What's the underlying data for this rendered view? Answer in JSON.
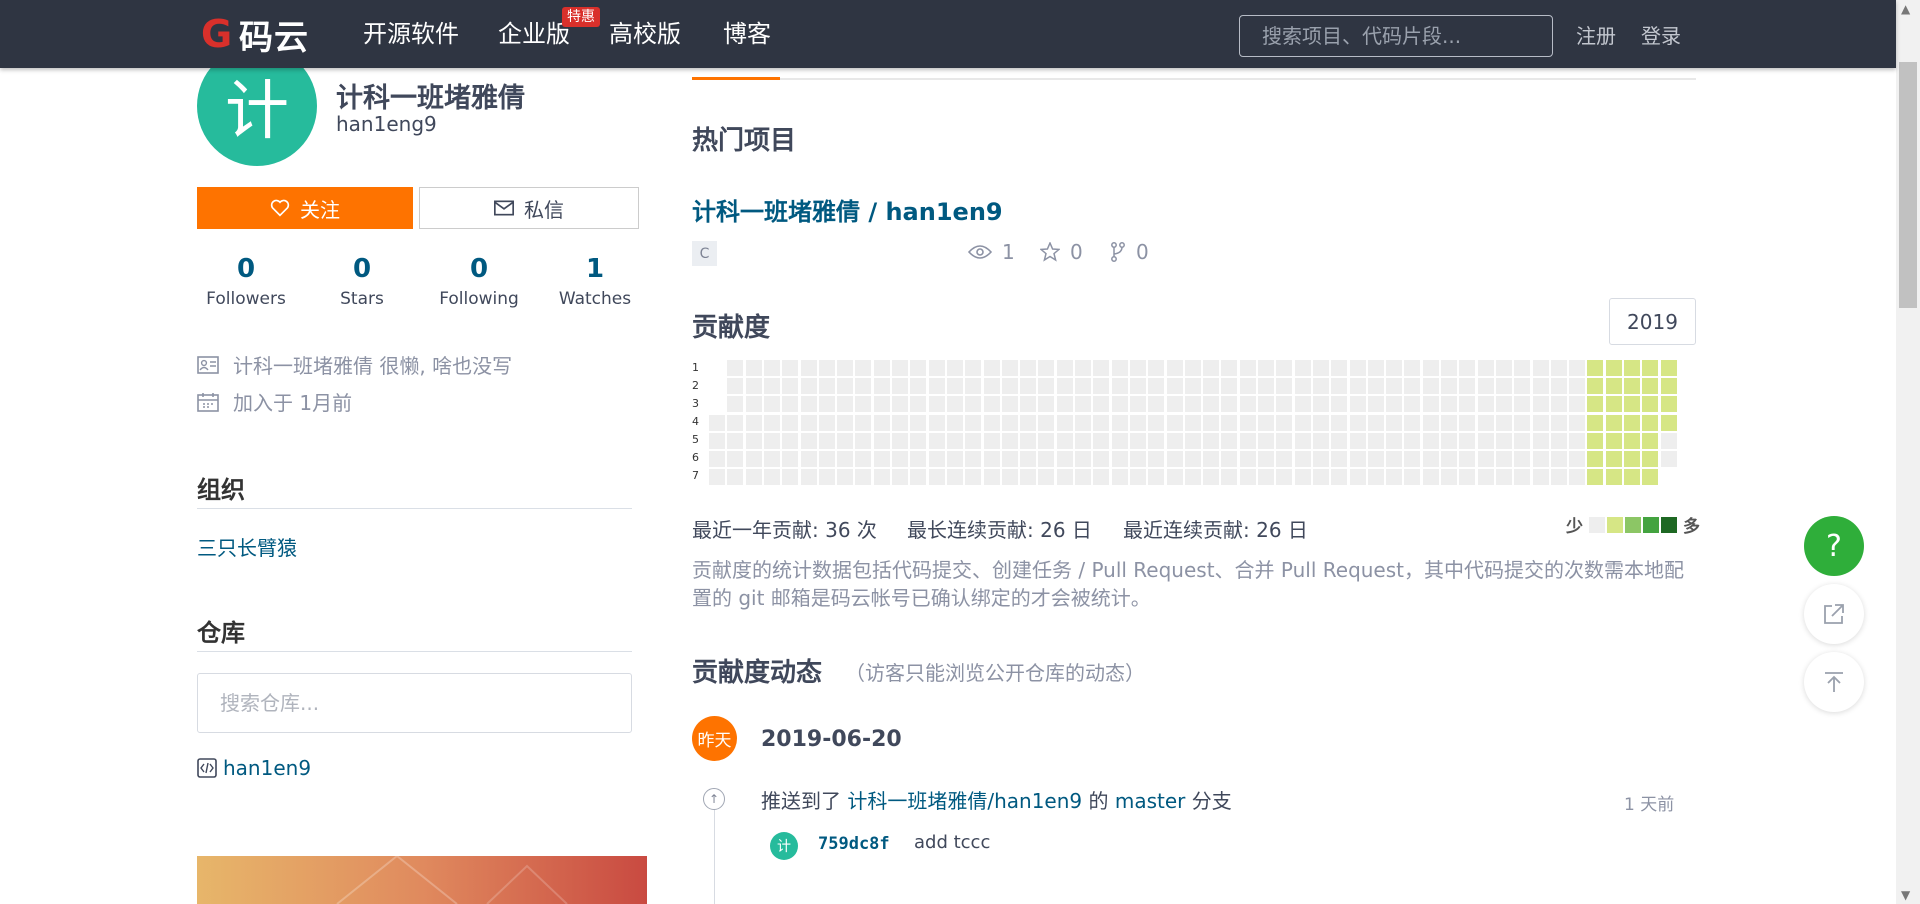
{
  "header": {
    "logo_text": "码云",
    "nav": [
      "开源软件",
      "企业版",
      "高校版",
      "博客"
    ],
    "badge": "特惠",
    "search_placeholder": "搜索项目、代码片段...",
    "register": "注册",
    "login": "登录"
  },
  "user": {
    "avatar_char": "计",
    "name": "计科一班堵雅倩",
    "login": "han1eng9",
    "follow_label": "关注",
    "message_label": "私信",
    "stats": [
      {
        "num": "0",
        "label": "Followers"
      },
      {
        "num": "0",
        "label": "Stars"
      },
      {
        "num": "0",
        "label": "Following"
      },
      {
        "num": "1",
        "label": "Watches"
      }
    ],
    "bio": "计科一班堵雅倩 很懒, 啥也没写",
    "joined": "加入于 1月前"
  },
  "org": {
    "title": "组织",
    "items": [
      "三只长臂猿"
    ]
  },
  "repos": {
    "title": "仓库",
    "search_placeholder": "搜索仓库...",
    "items": [
      "han1en9"
    ]
  },
  "hot": {
    "title": "热门项目",
    "project_name": "计科一班堵雅倩 / han1en9",
    "language": "C",
    "watch": "1",
    "star": "0",
    "fork": "0"
  },
  "contrib": {
    "title": "贡献度",
    "year": "2019",
    "day_labels": [
      "1",
      "2",
      "3",
      "4",
      "5",
      "6",
      "7"
    ],
    "weeks": 53,
    "total": "最近一年贡献: 36 次",
    "longest": "最长连续贡献: 26 日",
    "current": "最近连续贡献: 26 日",
    "legend_less": "少",
    "legend_more": "多",
    "levels_colors": [
      "#eeeeee",
      "#d6e685",
      "#8cc665",
      "#44a340",
      "#1e6823"
    ],
    "note": "贡献度的统计数据包括代码提交、创建任务 / Pull Request、合并 Pull Request，其中代码提交的次数需本地配置的 git 邮箱是码云帐号已确认绑定的才会被统计。"
  },
  "activity": {
    "title": "贡献度动态",
    "subtitle": "（访客只能浏览公开仓库的动态）",
    "date_badge": "昨天",
    "date": "2019-06-20",
    "push_prefix": "推送到了",
    "push_repo": "计科一班堵雅倩/han1en9",
    "push_mid": "的",
    "push_branch": "master",
    "push_suffix": "分支",
    "time": "1 天前",
    "commit_avatar": "计",
    "commit_sha": "759dc8f",
    "commit_msg": "add tccc"
  },
  "float": {
    "help": "?"
  }
}
